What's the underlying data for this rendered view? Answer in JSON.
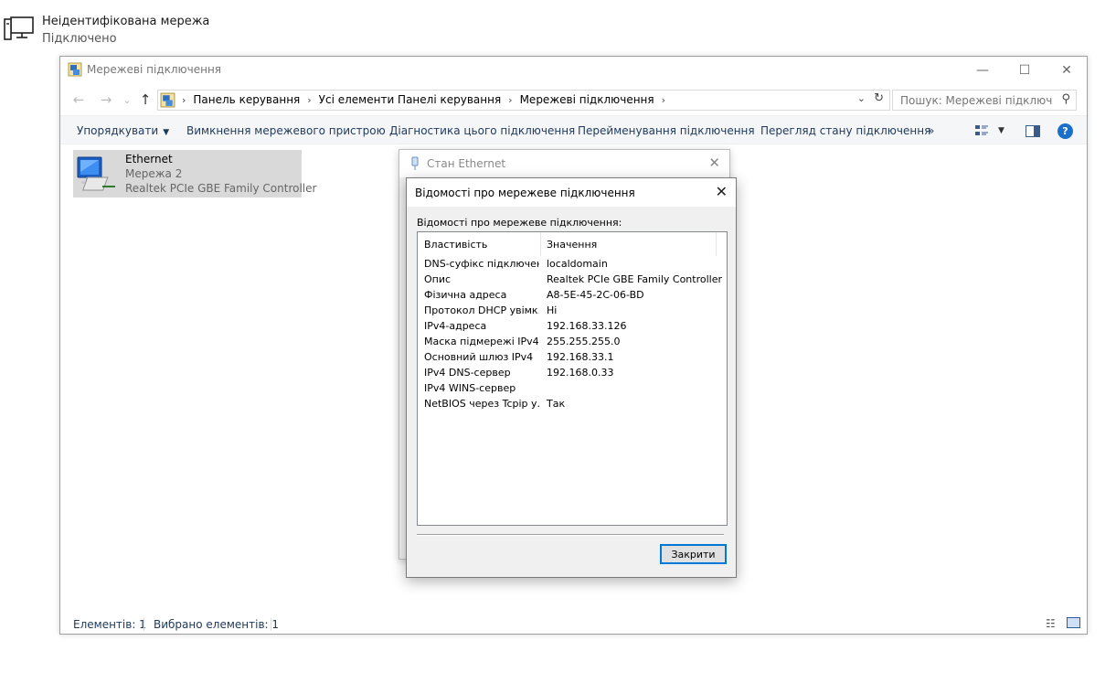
{
  "network_status": {
    "title": "Неідентифікована мережа",
    "subtitle": "Підключено",
    "icon": "network-computer-icon"
  },
  "explorer": {
    "title": "Мережеві підключення",
    "window_buttons": {
      "minimize": "—",
      "maximize": "☐",
      "close": "✕"
    },
    "nav": {
      "back": "←",
      "forward": "→",
      "recent": "⌄",
      "up": "↑"
    },
    "breadcrumbs": [
      "Панель керування",
      "Усі елементи Панелі керування",
      "Мережеві підключення"
    ],
    "search": {
      "placeholder": "Пошук: Мережеві підключе..."
    },
    "commands": {
      "organize": "Упорядкувати",
      "disable": "Вимкнення мережевого пристрою",
      "diagnose": "Діагностика цього підключення",
      "rename": "Перейменування підключення",
      "view_status": "Перегляд стану підключення",
      "more": "»"
    },
    "items": [
      {
        "name": "Ethernet",
        "network": "Мережа 2",
        "adapter": "Realtek PCIe GBE Family Controller"
      }
    ],
    "status": {
      "count": "Елементів: 1",
      "selected": "Вибрано елементів: 1"
    }
  },
  "status_dialog": {
    "title": "Стан Ethernet",
    "close": "✕"
  },
  "details_dialog": {
    "title": "Відомості про мережеве підключення",
    "close": "✕",
    "label": "Відомості про мережеве підключення:",
    "columns": {
      "property": "Властивість",
      "value": "Значення"
    },
    "rows": [
      {
        "k": "DNS-суфікс підключення",
        "v": "localdomain"
      },
      {
        "k": "Опис",
        "v": "Realtek PCIe GBE Family Controller"
      },
      {
        "k": "Фізична адреса",
        "v": "A8-5E-45-2C-06-BD"
      },
      {
        "k": "Протокол DHCP увімк...",
        "v": "Ні"
      },
      {
        "k": "IPv4-адреса",
        "v": "192.168.33.126"
      },
      {
        "k": "Маска підмережі IPv4",
        "v": "255.255.255.0"
      },
      {
        "k": "Основний шлюз IPv4",
        "v": "192.168.33.1"
      },
      {
        "k": "IPv4 DNS-сервер",
        "v": "192.168.0.33"
      },
      {
        "k": "IPv4 WINS-сервер",
        "v": ""
      },
      {
        "k": "NetBIOS через Tcpip у...",
        "v": "Так"
      }
    ],
    "button": "Закрити"
  }
}
